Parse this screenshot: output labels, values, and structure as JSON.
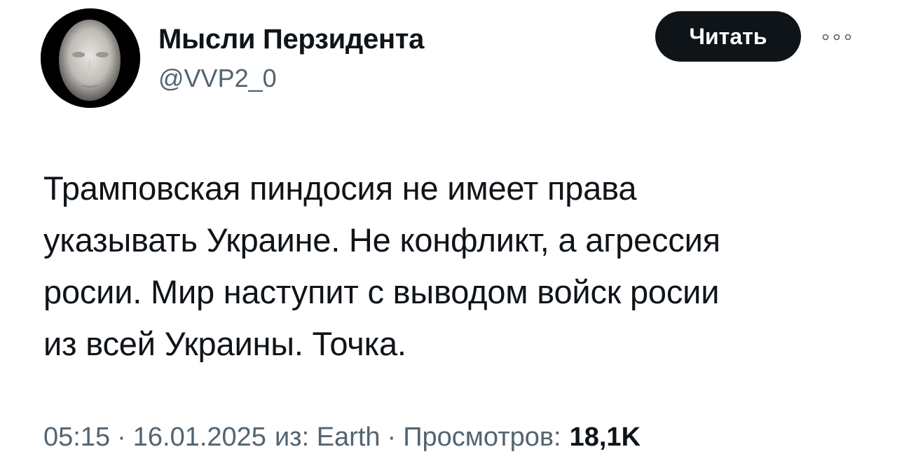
{
  "author": {
    "display_name": "Мысли Перзидента",
    "handle": "@VVP2_0",
    "avatar_icon": "death-mask-portrait"
  },
  "actions": {
    "follow_label": "Читать",
    "more_icon": "more-dots-icon"
  },
  "tweet": {
    "text_lines": [
      "Трамповская пиндосия не имеет права",
      "указывать Украине. Не конфликт, а агрессия",
      "росии. Мир наступит с выводом войск росии",
      "из всей Украины. Точка."
    ]
  },
  "meta": {
    "time": "05:15",
    "separator": "·",
    "date": "16.01.2025",
    "source": "из: Earth",
    "views_label": "Просмотров:",
    "views_count": "18,1K"
  },
  "colors": {
    "text_primary": "#0f1419",
    "text_secondary": "#536471",
    "button_bg": "#0f1419",
    "button_text": "#ffffff"
  }
}
